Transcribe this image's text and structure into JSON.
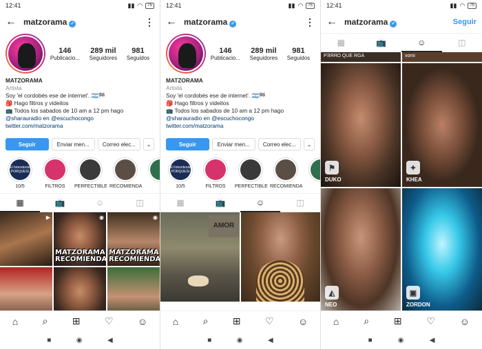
{
  "status": {
    "time": "12:41",
    "battery": "75"
  },
  "profile": {
    "username": "matzorama",
    "stats": [
      {
        "number": "146",
        "label": "Publicacio..."
      },
      {
        "number": "289 mil",
        "label": "Seguidores"
      },
      {
        "number": "981",
        "label": "Seguidos"
      }
    ],
    "name": "MATZORAMA",
    "category": "Artista",
    "bio_line1": "Soy 'el cordobés ese de internet'. 🇦🇷🏁",
    "bio_line2": "🎒 Hago filtros y videitos",
    "bio_line3": "📺 Todos los sabados de 10 am a 12 pm hago",
    "bio_line4": "@sharauradio en @escuchocongo",
    "link": "twitter.com/matzorama",
    "buttons": {
      "follow": "Seguir",
      "message": "Enviar men...",
      "email": "Correo elec...",
      "more": "⌄"
    }
  },
  "highlights": [
    {
      "label": "10/5",
      "cover": "El Intendente PORQUESI"
    },
    {
      "label": "FILTROS",
      "cover": ""
    },
    {
      "label": "PERFECTIBLE",
      "cover": ""
    },
    {
      "label": "RECOMIENDA",
      "cover": ""
    },
    {
      "label": "",
      "cover": ""
    }
  ],
  "grid_captions": [
    "MATZORAMA RECOMIENDA",
    "MATZORAMA RECOMIENDA"
  ],
  "tv_sign": "AMOR",
  "effects": [
    {
      "name": "DUKO"
    },
    {
      "name": "KHEA"
    },
    {
      "name": "NEO"
    },
    {
      "name": "ZORDON"
    }
  ],
  "top_labels": [
    "PƎЯЯO QUE RGA",
    "vomi"
  ],
  "follow_link": "Seguir"
}
